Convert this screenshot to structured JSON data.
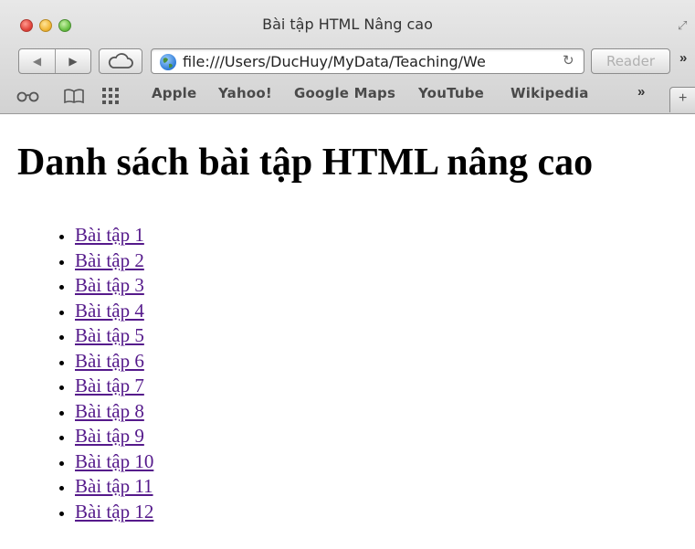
{
  "window": {
    "title": "Bài tập HTML Nâng cao"
  },
  "toolbar": {
    "address": "file:///Users/DucHuy/MyData/Teaching/We",
    "reader_label": "Reader",
    "more_label": "»"
  },
  "bookmarks": {
    "items": [
      {
        "label": "Apple"
      },
      {
        "label": "Yahoo!"
      },
      {
        "label": "Google Maps"
      },
      {
        "label": "YouTube"
      },
      {
        "label": "Wikipedia"
      }
    ],
    "more_label": "»",
    "new_tab_label": "+"
  },
  "page": {
    "heading": "Danh sách bài tập HTML nâng cao",
    "exercises": [
      {
        "label": "Bài tập 1"
      },
      {
        "label": "Bài tập 2"
      },
      {
        "label": "Bài tập 3"
      },
      {
        "label": "Bài tập 4"
      },
      {
        "label": "Bài tập 5"
      },
      {
        "label": "Bài tập 6"
      },
      {
        "label": "Bài tập 7"
      },
      {
        "label": "Bài tập 8"
      },
      {
        "label": "Bài tập 9"
      },
      {
        "label": "Bài tập 10"
      },
      {
        "label": "Bài tập 11"
      },
      {
        "label": "Bài tập 12"
      }
    ]
  },
  "colors": {
    "visited_link": "#551a8b",
    "chrome_top": "#e8e8e8",
    "chrome_bottom": "#d2d2d2"
  }
}
